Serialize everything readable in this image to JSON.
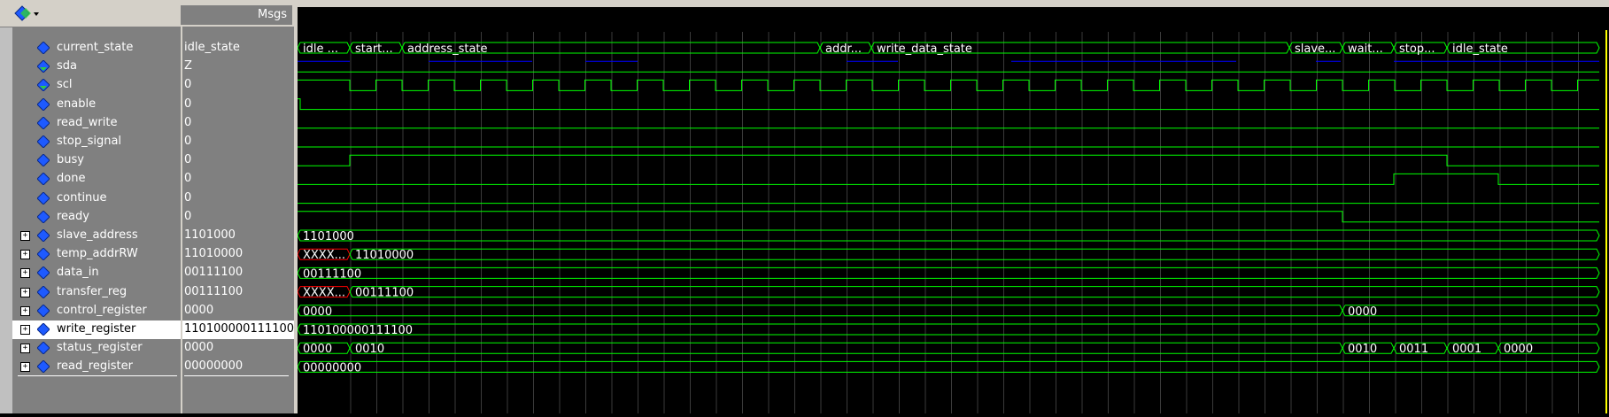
{
  "header": {
    "msgs_label": "Msgs"
  },
  "signals": [
    {
      "name": "current_state",
      "value": "idle_state",
      "expandable": false
    },
    {
      "name": "sda",
      "value": "Z",
      "expandable": false
    },
    {
      "name": "scl",
      "value": "0",
      "expandable": false
    },
    {
      "name": "enable",
      "value": "0",
      "expandable": false
    },
    {
      "name": "read_write",
      "value": "0",
      "expandable": false
    },
    {
      "name": "stop_signal",
      "value": "0",
      "expandable": false
    },
    {
      "name": "busy",
      "value": "0",
      "expandable": false
    },
    {
      "name": "done",
      "value": "0",
      "expandable": false
    },
    {
      "name": "continue",
      "value": "0",
      "expandable": false
    },
    {
      "name": "ready",
      "value": "0",
      "expandable": false
    },
    {
      "name": "slave_address",
      "value": "1101000",
      "expandable": true
    },
    {
      "name": "temp_addrRW",
      "value": "11010000",
      "expandable": true
    },
    {
      "name": "data_in",
      "value": "00111100",
      "expandable": true
    },
    {
      "name": "transfer_reg",
      "value": "00111100",
      "expandable": true
    },
    {
      "name": "control_register",
      "value": "0000",
      "expandable": true
    },
    {
      "name": "write_register",
      "value": "110100000111100",
      "expandable": true,
      "selected": true
    },
    {
      "name": "status_register",
      "value": "0000",
      "expandable": true
    },
    {
      "name": "read_register",
      "value": "00000000",
      "expandable": true
    }
  ],
  "bus_labels": {
    "current_state": [
      "idle ...",
      "start...",
      "address_state",
      "addr...",
      "write_data_state",
      "slave...",
      "wait...",
      "stop...",
      "idle_state"
    ],
    "slave_address": [
      "1101000"
    ],
    "temp_addrRW": [
      "XXXX...",
      "11010000"
    ],
    "data_in": [
      "00111100"
    ],
    "transfer_reg": [
      "XXXX...",
      "00111100"
    ],
    "control_register": [
      "0000",
      "0000"
    ],
    "write_register": [
      "110100000111100"
    ],
    "status_register": [
      "0000",
      "0010",
      "0010",
      "0011",
      "0001",
      "0000"
    ],
    "read_register": [
      "00000000"
    ]
  },
  "colors": {
    "wave_green": "#00ff00",
    "wave_blue": "#0000ff",
    "undefined_red": "#ff0000",
    "cursor_yellow": "#ffff00",
    "diamond_blue": "#1e5aff"
  }
}
